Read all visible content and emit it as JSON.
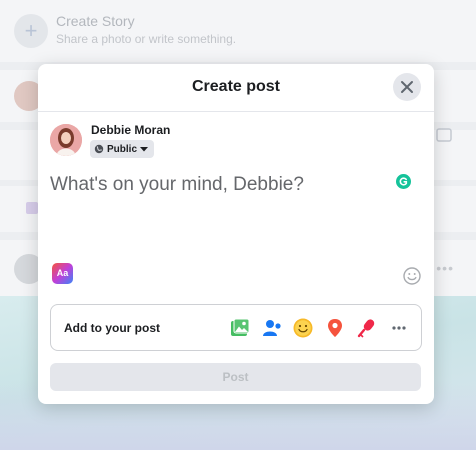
{
  "background": {
    "story": {
      "title": "Create Story",
      "subtitle": "Share a photo or write something."
    }
  },
  "modal": {
    "title": "Create post",
    "author": {
      "name": "Debbie Moran",
      "privacy": "Public"
    },
    "composer_placeholder": "What's on your mind, Debbie?",
    "background_toggle_label": "Aa",
    "add_to_post": {
      "label": "Add to your post",
      "icons": [
        "photo-video-icon",
        "tag-people-icon",
        "feeling-activity-icon",
        "check-in-icon",
        "live-video-icon",
        "more-icon"
      ]
    },
    "post_button": "Post"
  },
  "colors": {
    "photo": "#45bd62",
    "tag": "#1877f2",
    "feeling": "#f7b928",
    "checkin": "#f5533d",
    "live": "#f02849",
    "grammarly": "#15c39a",
    "disabled_bg": "#e4e6eb"
  }
}
